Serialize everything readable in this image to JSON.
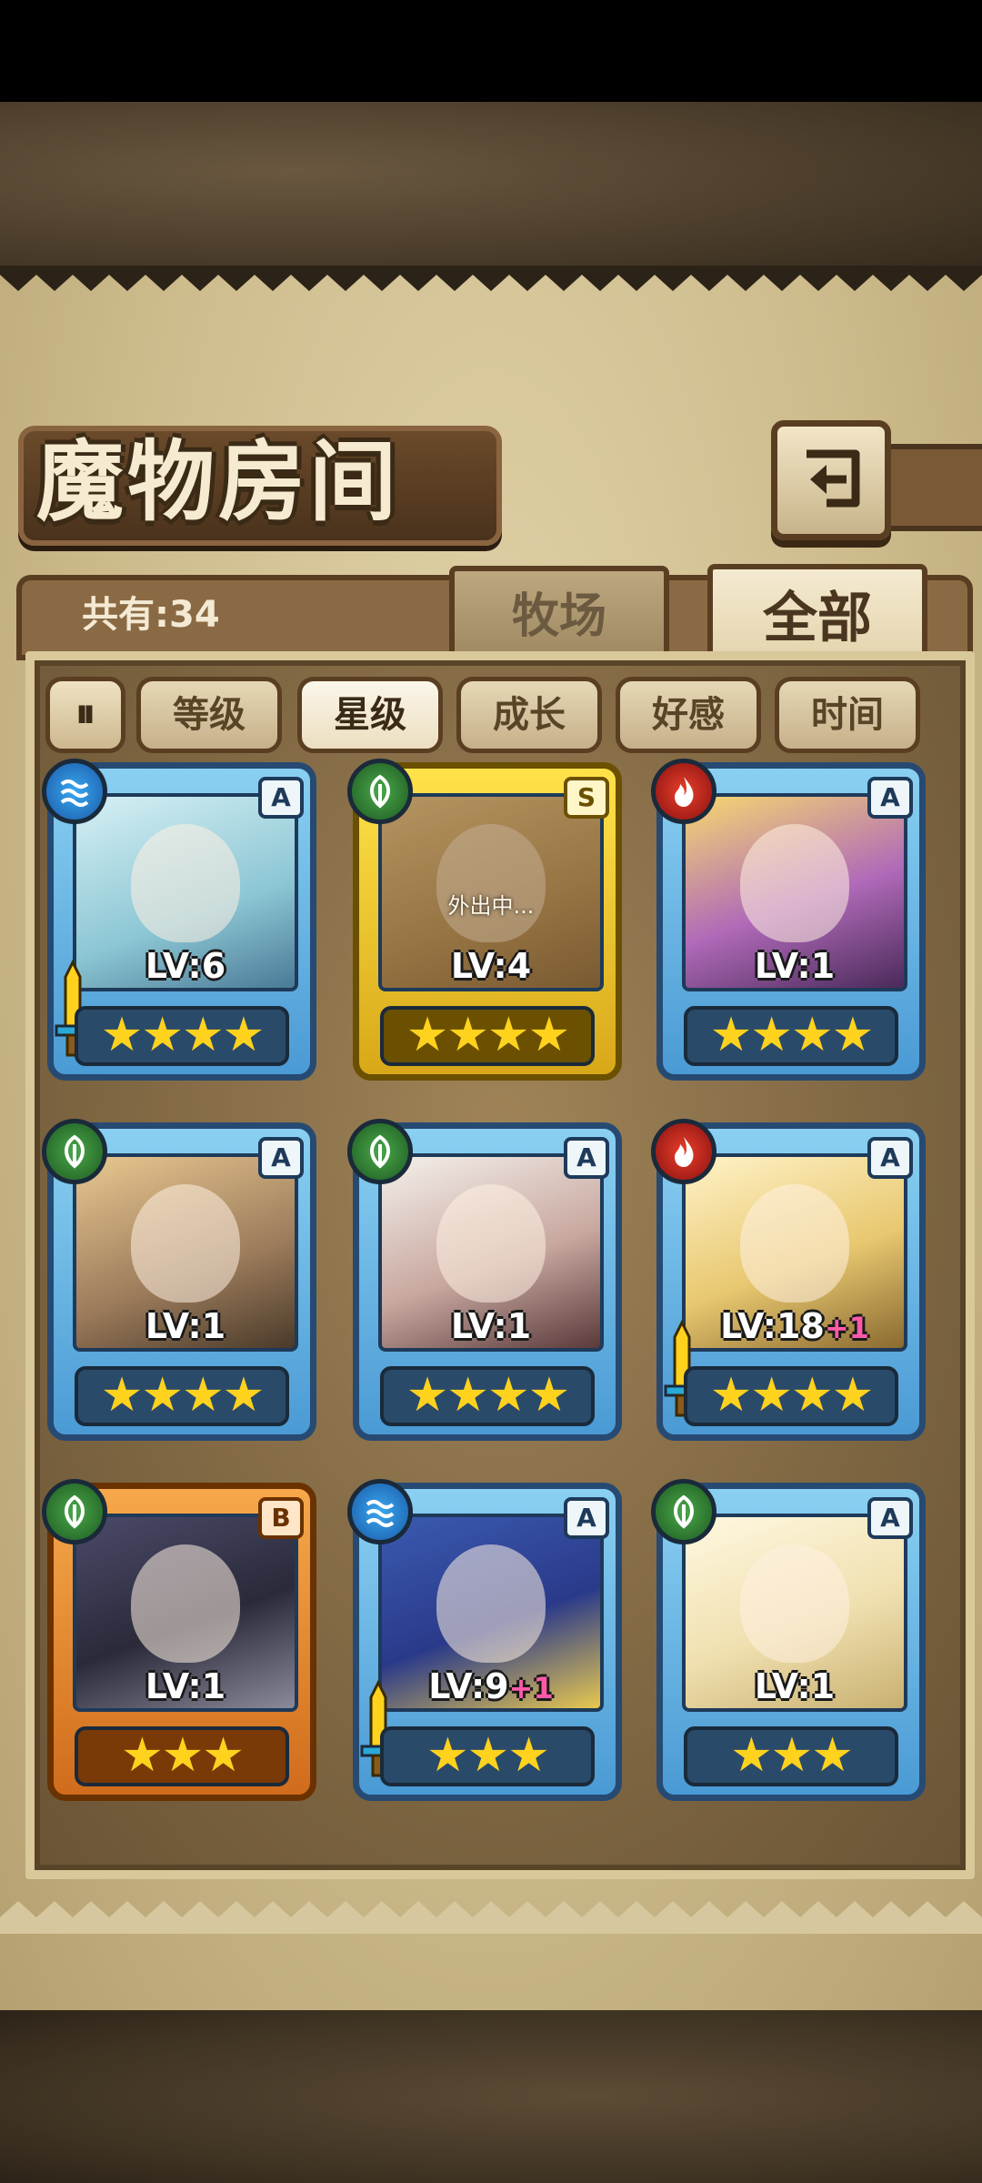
{
  "header": {
    "title": "魔物房间",
    "count": "共有:34"
  },
  "tabs": {
    "ranch": "牧场",
    "all": "全部"
  },
  "sort": {
    "toggle_icon": "⏸"
  },
  "filters": [
    {
      "label": "等级",
      "active": false
    },
    {
      "label": "星级",
      "active": true
    },
    {
      "label": "成长",
      "active": false
    },
    {
      "label": "好感",
      "active": false
    },
    {
      "label": "时间",
      "active": false
    }
  ],
  "monsters": [
    {
      "level": "LV:6",
      "bonus": "",
      "rank": "A",
      "element": "water",
      "stars": "★★★★",
      "frame": "blue",
      "status": ""
    },
    {
      "level": "LV:4",
      "bonus": "",
      "rank": "S",
      "element": "grass",
      "stars": "★★★★",
      "frame": "gold",
      "status": "外出中..."
    },
    {
      "level": "LV:1",
      "bonus": "",
      "rank": "A",
      "element": "fire",
      "stars": "★★★★",
      "frame": "blue",
      "status": ""
    },
    {
      "level": "LV:1",
      "bonus": "",
      "rank": "A",
      "element": "grass",
      "stars": "★★★★",
      "frame": "blue",
      "status": ""
    },
    {
      "level": "LV:1",
      "bonus": "",
      "rank": "A",
      "element": "grass",
      "stars": "★★★★",
      "frame": "blue",
      "status": ""
    },
    {
      "level": "LV:18",
      "bonus": "+1",
      "rank": "A",
      "element": "fire",
      "stars": "★★★★",
      "frame": "blue",
      "status": ""
    },
    {
      "level": "LV:1",
      "bonus": "",
      "rank": "B",
      "element": "grass",
      "stars": "★★★",
      "frame": "orange",
      "status": ""
    },
    {
      "level": "LV:9",
      "bonus": "+1",
      "rank": "A",
      "element": "water",
      "stars": "★★★",
      "frame": "blue",
      "status": ""
    },
    {
      "level": "LV:1",
      "bonus": "",
      "rank": "A",
      "element": "grass",
      "stars": "★★★",
      "frame": "blue",
      "status": ""
    }
  ],
  "colors": {
    "water": "#1a5aa8",
    "grass": "#1e5a22",
    "fire": "#8a1010",
    "star": "#ffd21e",
    "bonus": "#ff5aa8"
  }
}
